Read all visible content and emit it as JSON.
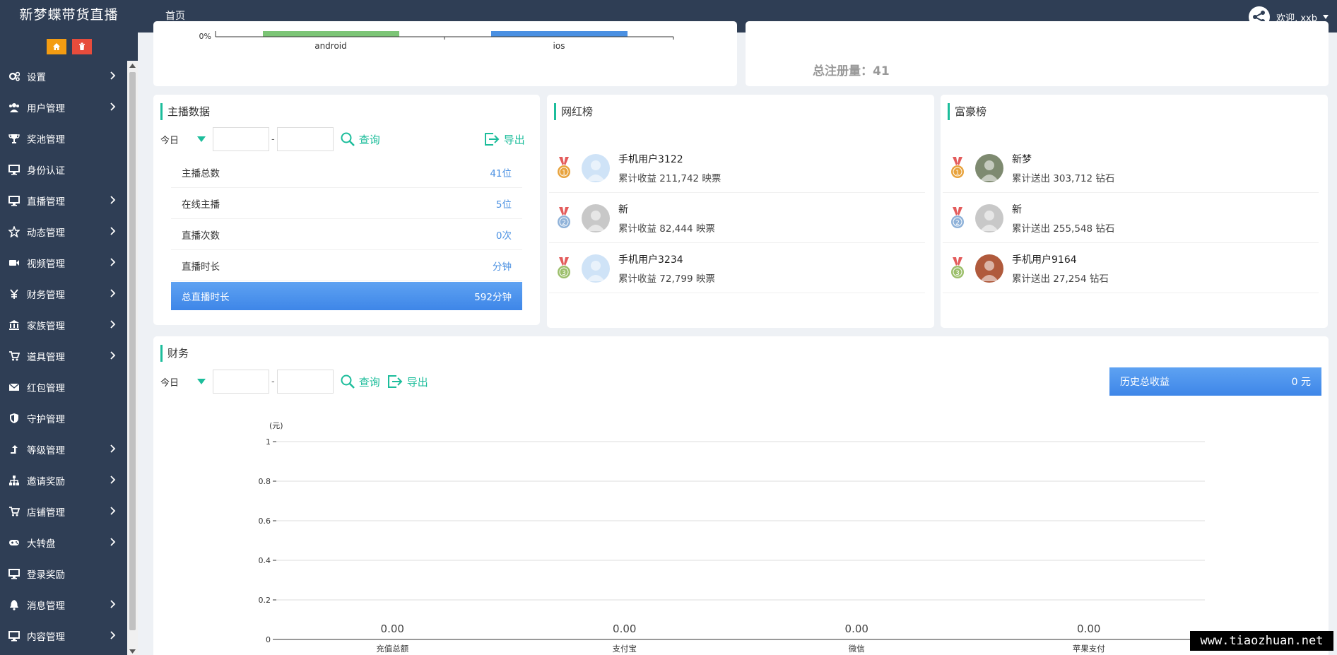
{
  "app": {
    "brand": "新梦蝶带货直播",
    "nav_home": "首页",
    "welcome": "欢迎, xxb"
  },
  "sidebar": {
    "items": [
      {
        "label": "设置",
        "icon": "gears-icon",
        "arrow": true
      },
      {
        "label": "用户管理",
        "icon": "users-icon",
        "arrow": true
      },
      {
        "label": "奖池管理",
        "icon": "trophy-icon",
        "arrow": false
      },
      {
        "label": "身份认证",
        "icon": "monitor-icon",
        "arrow": false
      },
      {
        "label": "直播管理",
        "icon": "monitor-icon",
        "arrow": true
      },
      {
        "label": "动态管理",
        "icon": "star-icon",
        "arrow": true
      },
      {
        "label": "视频管理",
        "icon": "video-camera-icon",
        "arrow": true
      },
      {
        "label": "财务管理",
        "icon": "yen-icon",
        "arrow": true
      },
      {
        "label": "家族管理",
        "icon": "bank-icon",
        "arrow": true
      },
      {
        "label": "道具管理",
        "icon": "cart-icon",
        "arrow": true
      },
      {
        "label": "红包管理",
        "icon": "envelope-icon",
        "arrow": false
      },
      {
        "label": "守护管理",
        "icon": "shield-icon",
        "arrow": false
      },
      {
        "label": "等级管理",
        "icon": "level-up-icon",
        "arrow": true
      },
      {
        "label": "邀请奖励",
        "icon": "sitemap-icon",
        "arrow": true
      },
      {
        "label": "店铺管理",
        "icon": "cart-icon",
        "arrow": true
      },
      {
        "label": "大转盘",
        "icon": "gamepad-icon",
        "arrow": true
      },
      {
        "label": "登录奖励",
        "icon": "monitor-icon",
        "arrow": false
      },
      {
        "label": "消息管理",
        "icon": "bell-icon",
        "arrow": true
      },
      {
        "label": "内容管理",
        "icon": "monitor-icon",
        "arrow": true
      }
    ]
  },
  "device_chart": {
    "y_tick": "0%",
    "categories": [
      "android",
      "ios"
    ],
    "colors": [
      "#7cc576",
      "#4a90e2"
    ]
  },
  "registrations": {
    "label": "总注册量：41"
  },
  "anchor": {
    "title": "主播数据",
    "filter": {
      "period": "今日",
      "query": "查询",
      "export": "导出"
    },
    "rows": [
      {
        "label": "主播总数",
        "value": "41位"
      },
      {
        "label": "在线主播",
        "value": "5位"
      },
      {
        "label": "直播次数",
        "value": "0次"
      },
      {
        "label": "直播时长",
        "value": "分钟"
      }
    ],
    "total": {
      "label": "总直播时长",
      "value": "592分钟"
    }
  },
  "celebrity": {
    "title": "网红榜",
    "entries": [
      {
        "rank": 1,
        "name": "手机用户3122",
        "sub": "累计收益  211,742 映票"
      },
      {
        "rank": 2,
        "name": "新",
        "sub": "累计收益  82,444 映票"
      },
      {
        "rank": 3,
        "name": "手机用户3234",
        "sub": "累计收益  72,799 映票"
      }
    ]
  },
  "rich": {
    "title": "富豪榜",
    "entries": [
      {
        "rank": 1,
        "name": "新梦",
        "sub": "累计送出  303,712 钻石"
      },
      {
        "rank": 2,
        "name": "新",
        "sub": "累计送出  255,548 钻石"
      },
      {
        "rank": 3,
        "name": "手机用户9164",
        "sub": "累计送出  27,254 钻石"
      }
    ]
  },
  "finance": {
    "title": "财务",
    "filter": {
      "period": "今日",
      "query": "查询",
      "export": "导出"
    },
    "history": {
      "label": "历史总收益",
      "value": "0 元"
    }
  },
  "chart_data": {
    "type": "bar",
    "ylabel": "(元)",
    "ylim": [
      0,
      1
    ],
    "yticks": [
      0,
      0.2,
      0.4,
      0.6,
      0.8,
      1
    ],
    "categories": [
      "充值总额",
      "支付宝",
      "微信",
      "苹果支付"
    ],
    "values": [
      0,
      0,
      0,
      0
    ],
    "data_labels": [
      "0.00",
      "0.00",
      "0.00",
      "0.00"
    ],
    "grid": true
  },
  "watermark": "www.tiaozhuan.net"
}
